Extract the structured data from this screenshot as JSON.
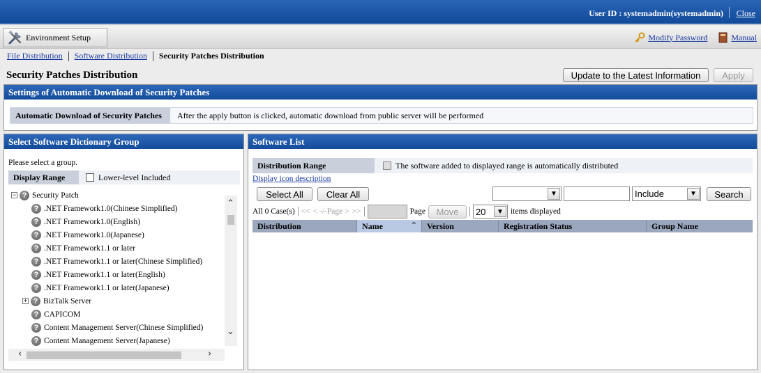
{
  "header": {
    "user": "User ID : systemadmin(systemadmin)",
    "close": "Close"
  },
  "toolbar": {
    "env_setup": "Environment Setup",
    "modify_password": "Modify Password",
    "manual": "Manual"
  },
  "breadcrumb": {
    "file_distribution": "File Distribution",
    "software_distribution": "Software Distribution",
    "current": "Security Patches Distribution"
  },
  "page": {
    "title": "Security Patches Distribution",
    "update_button": "Update to the Latest Information",
    "apply_button": "Apply"
  },
  "auto_download": {
    "header": "Settings of Automatic Download of Security Patches",
    "label": "Automatic Download of Security Patches",
    "value": "After the apply button is clicked, automatic download from public server will be performed"
  },
  "dictionary": {
    "header": "Select Software Dictionary Group",
    "hint": "Please select a group.",
    "display_range_label": "Display Range",
    "lower_level_label": "Lower-level Included",
    "tree": [
      "Security Patch",
      ".NET Framework1.0(Chinese Simplified)",
      ".NET Framework1.0(English)",
      ".NET Framework1.0(Japanese)",
      ".NET Framework1.1 or later",
      ".NET Framework1.1 or later(Chinese Simplified)",
      ".NET Framework1.1 or later(English)",
      ".NET Framework1.1 or later(Japanese)",
      "BizTalk Server",
      "CAPICOM",
      "Content Management Server(Chinese Simplified)",
      "Content Management Server(Japanese)"
    ]
  },
  "software_list": {
    "header": "Software List",
    "distribution_range_label": "Distribution Range",
    "distribution_range_value": "The software added to displayed range is automatically distributed",
    "icon_description_link": "Display icon description",
    "select_all": "Select All",
    "clear_all": "Clear All",
    "filter_mode": "Include",
    "search": "Search",
    "case_count": "All 0 Case(s)",
    "nav_first": "<<",
    "nav_page": "< -/-Page >",
    "nav_last": ">>",
    "page_label": "Page",
    "move": "Move",
    "items_per_page": "20",
    "items_displayed": "items displayed",
    "columns": [
      "Distribution",
      "Name",
      "Version",
      "Registration Status",
      "Group Name"
    ]
  }
}
